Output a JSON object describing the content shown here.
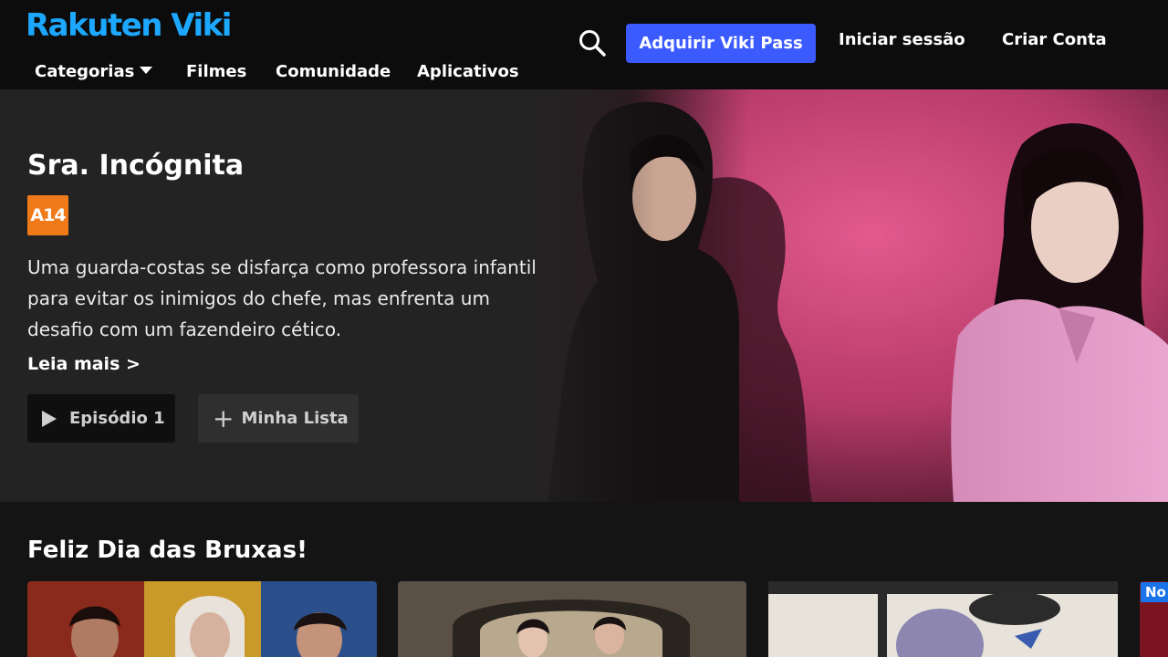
{
  "header": {
    "logo": "Rakuten Viki",
    "nav": [
      "Categorias",
      "Filmes",
      "Comunidade",
      "Aplicativos"
    ],
    "vikipass_label": "Adquirir Viki Pass",
    "login_label": "Iniciar sessão",
    "signup_label": "Criar Conta",
    "accent_color": "#3c5bff",
    "logo_color": "#1ca8ff"
  },
  "hero": {
    "title": "Sra. Incógnita",
    "rating": "A14",
    "description": "Uma guarda-costas se disfarça como professora infantil para evitar os inimigos do chefe, mas enfrenta um desafio com um fazendeiro cético.",
    "read_more": "Leia mais >",
    "episode_btn": "Episódio 1",
    "list_btn": "Minha Lista"
  },
  "row": {
    "title": "Feliz Dia das Bruxas!",
    "badge": "No"
  }
}
